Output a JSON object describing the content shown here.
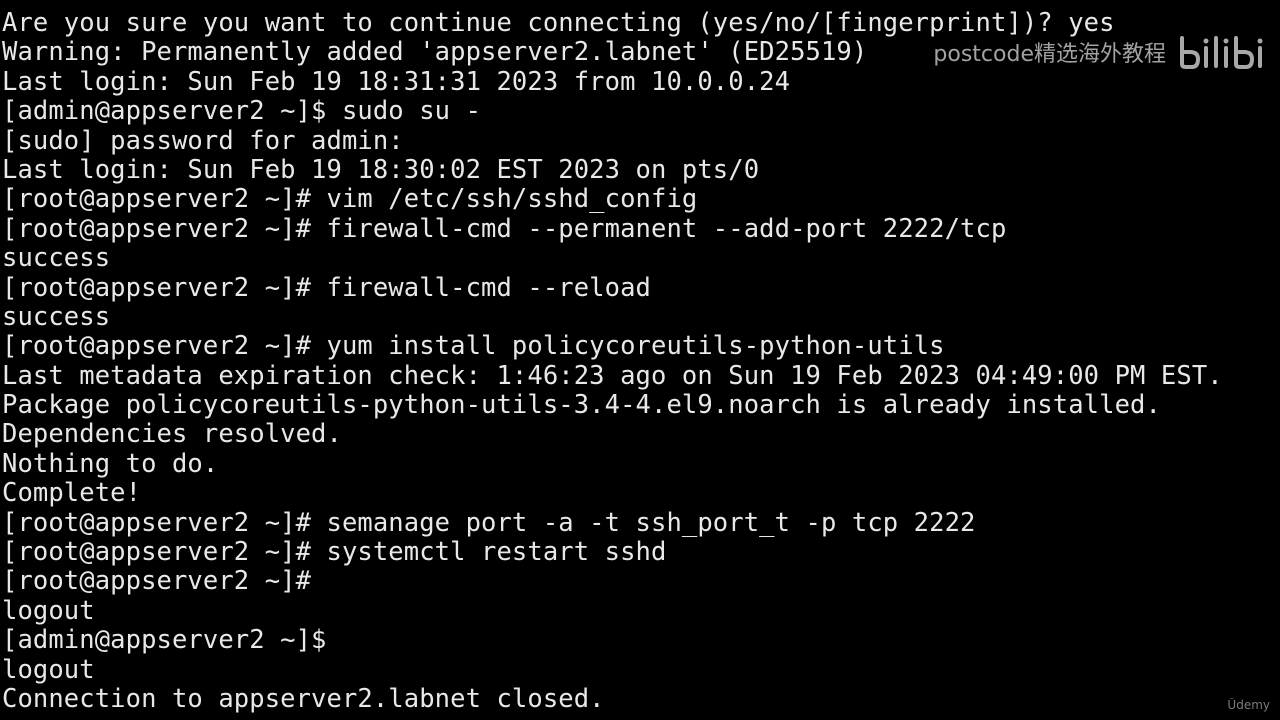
{
  "terminal": {
    "lines": [
      "Are you sure you want to continue connecting (yes/no/[fingerprint])? yes",
      "Warning: Permanently added 'appserver2.labnet' (ED25519)",
      "Last login: Sun Feb 19 18:31:31 2023 from 10.0.0.24",
      "[admin@appserver2 ~]$ sudo su -",
      "[sudo] password for admin:",
      "Last login: Sun Feb 19 18:30:02 EST 2023 on pts/0",
      "[root@appserver2 ~]# vim /etc/ssh/sshd_config",
      "[root@appserver2 ~]# firewall-cmd --permanent --add-port 2222/tcp",
      "success",
      "[root@appserver2 ~]# firewall-cmd --reload",
      "success",
      "[root@appserver2 ~]# yum install policycoreutils-python-utils",
      "Last metadata expiration check: 1:46:23 ago on Sun 19 Feb 2023 04:49:00 PM EST.",
      "Package policycoreutils-python-utils-3.4-4.el9.noarch is already installed.",
      "Dependencies resolved.",
      "Nothing to do.",
      "Complete!",
      "[root@appserver2 ~]# semanage port -a -t ssh_port_t -p tcp 2222",
      "[root@appserver2 ~]# systemctl restart sshd",
      "[root@appserver2 ~]#",
      "logout",
      "[admin@appserver2 ~]$",
      "logout",
      "Connection to appserver2.labnet closed."
    ]
  },
  "watermark": {
    "text": "postcode精选海外教程",
    "logo_icon": "bilibili-logo-icon"
  },
  "udemy": {
    "text": "Ūdemy"
  },
  "colors": {
    "background": "#000000",
    "text": "#e8e8e8"
  }
}
